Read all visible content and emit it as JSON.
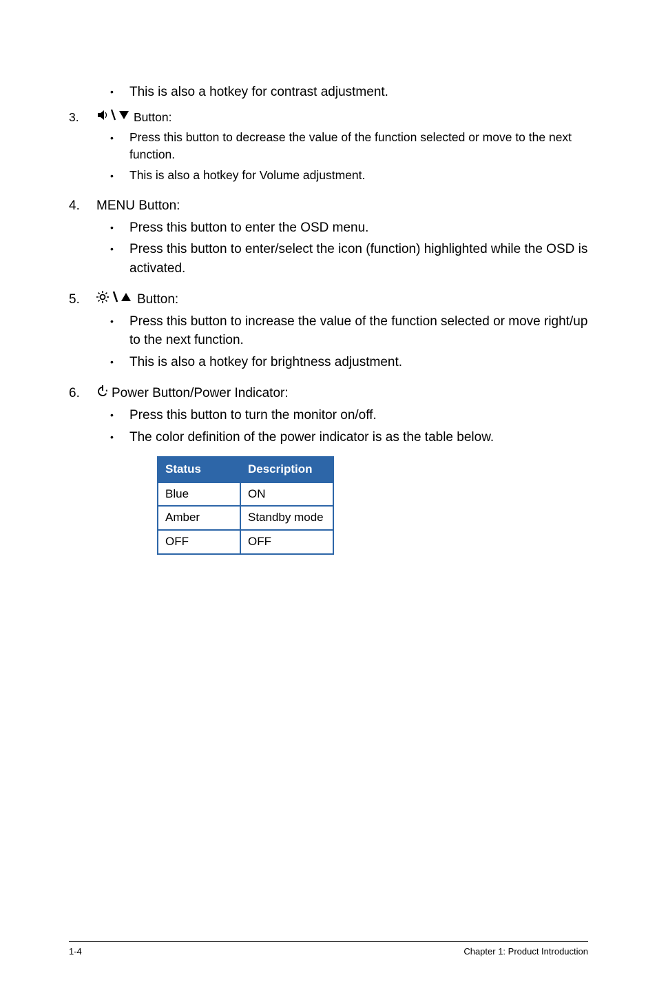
{
  "items": {
    "hotkey_contrast": "This is also a hotkey for contrast adjustment.",
    "item3": {
      "num": "3.",
      "label": "Button:",
      "bullets": [
        "Press this button to decrease the value of the function selected or move to the next function.",
        "This is also a hotkey for Volume adjustment."
      ]
    },
    "item4": {
      "num": "4.",
      "label": "MENU Button:",
      "bullets": [
        "Press this button to enter the OSD menu.",
        "Press this button to enter/select the icon (function) highlighted while the OSD is activated."
      ]
    },
    "item5": {
      "num": "5.",
      "label": "Button:",
      "bullets": [
        "Press this button to increase the value of the function selected or move right/up to the next function.",
        "This is also a hotkey for brightness adjustment."
      ]
    },
    "item6": {
      "num": "6.",
      "label": "Power Button/Power Indicator:",
      "bullets": [
        "Press this button to turn the monitor on/off.",
        "The color definition of the power indicator is as the table below."
      ]
    }
  },
  "table": {
    "headers": [
      "Status",
      "Description"
    ],
    "rows": [
      [
        "Blue",
        "ON"
      ],
      [
        "Amber",
        "Standby mode"
      ],
      [
        "OFF",
        "OFF"
      ]
    ]
  },
  "footer": {
    "left": "1-4",
    "right": "Chapter 1: Product Introduction"
  }
}
